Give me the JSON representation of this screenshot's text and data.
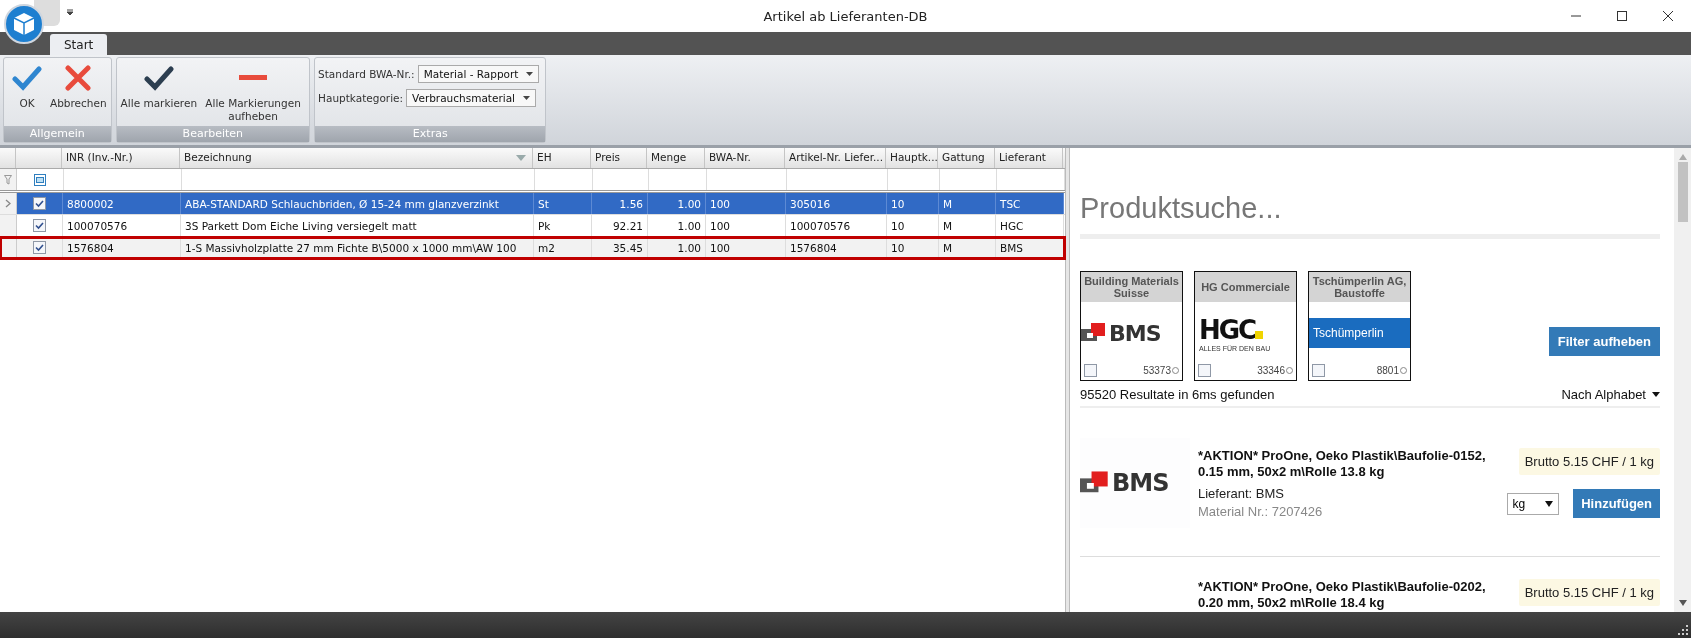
{
  "window": {
    "title": "Artikel ab Lieferanten-DB"
  },
  "ribbon": {
    "tabs": [
      {
        "label": "Start",
        "selected": true
      }
    ],
    "groups": [
      {
        "label": "Allgemein",
        "buttons": [
          {
            "label": "OK",
            "kind": "check"
          },
          {
            "label": "Abbrechen",
            "kind": "cross"
          }
        ]
      },
      {
        "label": "Bearbeiten",
        "buttons": [
          {
            "label": "Alle markieren",
            "kind": "darkcheck"
          },
          {
            "label": "Alle Markierungen aufheben",
            "kind": "minus"
          }
        ]
      },
      {
        "label": "Extras",
        "fields": [
          {
            "label": "Standard BWA-Nr.:",
            "value": "Material - Rapport"
          },
          {
            "label": "Hauptkategorie:",
            "value": "Verbrauchsmaterial"
          }
        ]
      }
    ]
  },
  "table": {
    "columns": [
      "INR (Inv.-Nr.)",
      "Bezeichnung",
      "EH",
      "Preis",
      "Menge",
      "BWA-Nr.",
      "Artikel-Nr. Liefer...",
      "Hauptk...",
      "Gattung",
      "Lieferant"
    ],
    "rows": [
      {
        "selected": true,
        "checked": true,
        "outlined": false,
        "cells": [
          "8800002",
          "ABA-STANDARD Schlauchbriden, Ø 15-24 mm glanzverzinkt",
          "St",
          "1.56",
          "1.00",
          "100",
          "305016",
          "10",
          "M",
          "TSC"
        ]
      },
      {
        "selected": false,
        "checked": true,
        "outlined": false,
        "cells": [
          "100070576",
          "3S Parkett Dom Eiche Living versiegelt matt",
          "Pk",
          "92.21",
          "1.00",
          "100",
          "100070576",
          "10",
          "M",
          "HGC"
        ]
      },
      {
        "selected": false,
        "checked": true,
        "outlined": true,
        "cells": [
          "1576804",
          "1-S Massivholzplatte 27 mm Fichte B\\5000 x 1000 mm\\AW 100",
          "m2",
          "35.45",
          "1.00",
          "100",
          "1576804",
          "10",
          "M",
          "BMS"
        ]
      }
    ]
  },
  "search": {
    "title": "Produktsuche...",
    "suppliers": [
      {
        "name": "Building Materials Suisse",
        "count": "53373",
        "checked": false,
        "kind": "bms",
        "logo_text": "BMS"
      },
      {
        "name": "HG Commerciale",
        "count": "33346",
        "checked": false,
        "kind": "hgc",
        "logo_text": "HGC",
        "logo_tagline": "ALLES FÜR DEN BAU"
      },
      {
        "name": "Tschümperlin AG, Baustoffe",
        "count": "8801",
        "checked": false,
        "kind": "tsc",
        "logo_text": "Tschümperlin"
      }
    ],
    "filter_button": "Filter aufheben",
    "results": "95520 Resultate in 6ms gefunden",
    "sort": "Nach Alphabet",
    "products": [
      {
        "name": "*AKTION* ProOne, Oeko Plastik\\Baufolie-0152, 0.15 mm, 50x2 m\\Rolle 13.8 kg",
        "supplier": "Lieferant: BMS",
        "material": "Material Nr.: 7207426",
        "price": "Brutto 5.15 CHF / 1 kg",
        "unit": "kg",
        "button": "Hinzufügen",
        "logo_text": "BMS"
      },
      {
        "name": "*AKTION* ProOne, Oeko Plastik\\Baufolie-0202, 0.20 mm, 50x2 m\\Rolle 18.4 kg",
        "price": "Brutto 5.15 CHF / 1 kg"
      }
    ]
  }
}
